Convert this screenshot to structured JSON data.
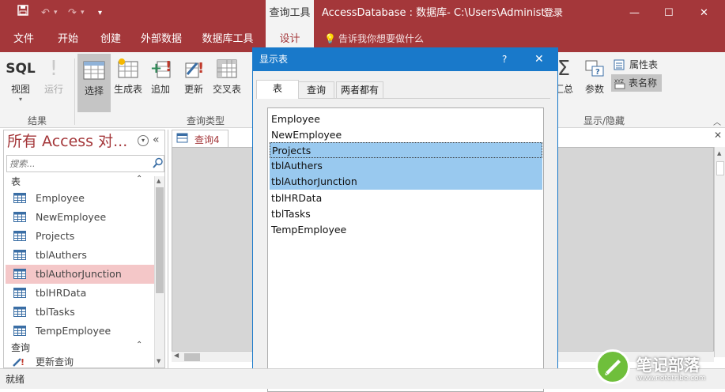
{
  "titlebar": {
    "context_tab": "查询工具",
    "title": "AccessDatabase : 数据库- C:\\Users\\Administ...",
    "login": "登录",
    "min": "—",
    "max": "☐",
    "close": "✕",
    "qat_save": "💾",
    "qat_undo": "↶",
    "qat_redo": "↷",
    "qat_more": "▾"
  },
  "ribbon_tabs": [
    "文件",
    "开始",
    "创建",
    "外部数据",
    "数据库工具"
  ],
  "design_tab": "设计",
  "tell_me": "告诉我你想要做什么",
  "ribbon": {
    "sql": "SQL",
    "view": "视图",
    "run": "运行",
    "select": "选择",
    "make_table": "生成表",
    "append": "追加",
    "update": "更新",
    "crosstab": "交叉表",
    "totals": "汇总",
    "params": "参数",
    "property_sheet": "属性表",
    "table_names": "表名称",
    "group_results": "结果",
    "group_query_type": "查询类型",
    "group_show_hide": "显示/隐藏"
  },
  "nav": {
    "header": "所有 Access 对...",
    "search_placeholder": "搜索...",
    "section_tables": "表",
    "tables": [
      "Employee",
      "NewEmployee",
      "Projects",
      "tblAuthers",
      "tblAuthorJunction",
      "tblHRData",
      "tblTasks",
      "TempEmployee"
    ],
    "highlighted": "tblAuthorJunction",
    "section_queries": "查询",
    "queries": [
      "更新查询"
    ]
  },
  "doc_tab": "查询4",
  "dialog": {
    "title": "显示表",
    "help": "?",
    "close": "✕",
    "tabs": [
      "表",
      "查询",
      "两者都有"
    ],
    "items": [
      "Employee",
      "NewEmployee",
      "Projects",
      "tblAuthers",
      "tblAuthorJunction",
      "tblHRData",
      "tblTasks",
      "TempEmployee"
    ],
    "selected": [
      "Projects",
      "tblAuthers",
      "tblAuthorJunction"
    ]
  },
  "status": {
    "text": "就绪"
  },
  "watermark": {
    "title": "笔记部落",
    "url": "www.notetribe.com"
  },
  "colors": {
    "accent": "#a4373a",
    "dialog_title": "#1979ca",
    "selection": "#99c9ef",
    "nav_highlight": "#f4c7c8"
  }
}
